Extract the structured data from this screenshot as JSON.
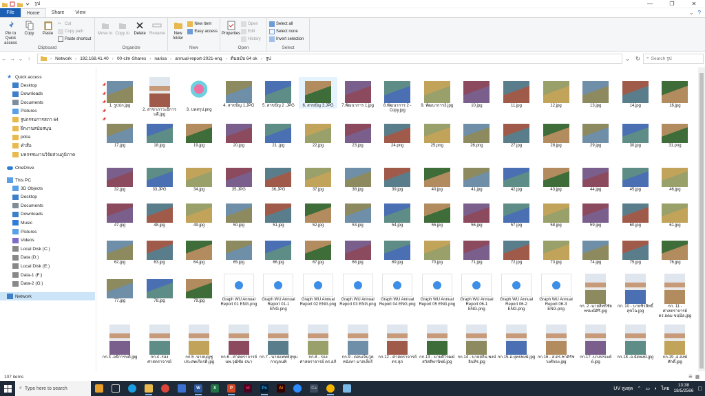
{
  "window": {
    "title": "รูป",
    "controls": [
      "—",
      "❐",
      "✕"
    ]
  },
  "tabs": [
    {
      "label": "File"
    },
    {
      "label": "Home"
    },
    {
      "label": "Share"
    },
    {
      "label": "View"
    }
  ],
  "ribbon": {
    "clipboard": {
      "label": "Clipboard",
      "pin": "Pin to Quick access",
      "copy": "Copy",
      "paste": "Paste",
      "cut": "Cut",
      "copy_path": "Copy path",
      "paste_shortcut": "Paste shortcut"
    },
    "organize": {
      "label": "Organize",
      "move_to": "Move to",
      "copy_to": "Copy to",
      "delete": "Delete",
      "rename": "Rename"
    },
    "new": {
      "label": "New",
      "new_folder": "New folder",
      "new_item": "New item",
      "easy_access": "Easy access"
    },
    "open": {
      "label": "Open",
      "properties": "Properties",
      "open": "Open",
      "edit": "Edit",
      "history": "History"
    },
    "select": {
      "label": "Select",
      "select_all": "Select all",
      "select_none": "Select none",
      "invert": "Invert selection"
    }
  },
  "address": {
    "crumbs": [
      "Network",
      "192.168.41.40",
      "00-clm-Shares",
      "narisa",
      "annual-report-2021-eng",
      "ต้นฉบับ 64 ok",
      "รูป"
    ]
  },
  "search": {
    "placeholder": "Search รูป"
  },
  "nav": {
    "quick_access": "Quick access",
    "quick_items": [
      "Desktop",
      "Downloads",
      "Documents",
      "Pictures",
      "รูปกรรมการสภา 64",
      "ฝึกงานสนับสนุน",
      "pdca",
      "ทำสื่อ",
      "มหกรรมงานวิจัยส่วนภูมิภาค"
    ],
    "onedrive": "OneDrive",
    "this_pc": "This PC",
    "pc_items": [
      "3D Objects",
      "Desktop",
      "Documents",
      "Downloads",
      "Music",
      "Pictures",
      "Videos",
      "Local Disk (C:)",
      "Data (D:)",
      "Local Disk (E:)",
      "Data-1 (F:)",
      "Data-2 (G:)"
    ],
    "network": "Network"
  },
  "files": [
    "1. รูปปก.jpg",
    "2. สาขาภาวะธิการบดี.jpg",
    "3. บทสรุป.png",
    "4. สาขปัญ 1.JPG",
    "5. สาขปัญ 2 .JPG",
    "6. สาขปัญ 3.JPG",
    "7.พัฒนาการ 1.jpg",
    "8.พัฒนาการ 2 - Copy.jpg",
    "9. พัฒนาการ3.jpg",
    "10.jpg",
    "11.jpg",
    "12.jpg",
    "13.jpg",
    "14.jpg",
    "16.jpg",
    "17.jpg",
    "18.jpg",
    "19.jpg",
    "20.jpg",
    "21 .jpg",
    "22.jpg",
    "23.jpg",
    "24.png",
    "25.png",
    "26.png",
    "27.jpg",
    "28.jpg",
    "29.jpg",
    "30.jpg",
    "31.png",
    "32.jpg",
    "33.JPG",
    "34.jpg",
    "35.JPG",
    "36.JPG",
    "37.jpg",
    "38.jpg",
    "39.jpg",
    "40.jpg",
    "41.jpg",
    "42.jpg",
    "43.jpg",
    "44.jpg",
    "45.jpg",
    "46.jpg",
    "47.jpg",
    "48.jpg",
    "49.jpg",
    "50.jpg",
    "51.jpg",
    "52.jpg",
    "53.jpg",
    "54.jpg",
    "55.jpg",
    "56.jpg",
    "57.jpg",
    "58.jpg",
    "59.jpg",
    "60.jpg",
    "61.jpg",
    "62.jpg",
    "63.jpg",
    "64.jpg",
    "65.jpg",
    "66.jpg",
    "67.jpg",
    "68.jpg",
    "69.jpg",
    "70.jpg",
    "71.jpg",
    "72.jpg",
    "73.jpg",
    "74.jpg",
    "75.jpg",
    "76.jpg",
    "77.jpg",
    "78.jpg",
    "79.jpg",
    "Graph WU Annual Report 01 ENG.png",
    "Graph WU Annual Report 01-1 ENG.png",
    "Graph WU Annual Report 02 ENG.png",
    "Graph WU Annual Report 03 ENG.png",
    "Graph WU Annual Report 04 ENG.png",
    "Graph WU Annual Report 05 ENG.png",
    "Graph WU Annual Report 06-1 ENG.png",
    "Graph WU Annual Report 06-2 ENG.png",
    "Graph WU Annual Report 06-3 ENG.png",
    "กก. 2 -นายสิทธิชัย พรมณีศิริ.jpg",
    "กก. 10 - นายชิรสิทธิ์ สุขโฉ.jpg",
    "กก. 11 - ศาสตราจารย์ ดร.อดม ขนฺนิล.jpg",
    "กก.3 -อธิการบดี.jpg",
    "กก.4 -รองศาสตราจารย์",
    "กก.5 -นายบุญชู ประสพเกียรติ.jpg",
    "กก.6 - ศาสตราจารย์ นพ.วุฒิชัย ธนา",
    "กก.7 - นายแพทย์สุขุม กาญจนพิ",
    "กก.8 - รองศาสตราจารย์ ดร.อภิ",
    "กก.9 - ดอนเจ็นวู่ด หนังหา มาสเลี่ยร์",
    "กก.12 - ศาสตราจารย์ ดร.สุภ",
    "กก.13 - นายศิโรฒม์ สวัสดิพานิชย์.jpg",
    "กก.14 - นายสถิน พงษ์อินทิร.jpg",
    "กก.15-อ.ยุทธพงษ์.jpg",
    "กก.16 - ส.ดร.ชาติรัช วงศ์จอง.jpg",
    "กก.17 -นางปรเมย์ผ์.jpg",
    "กก.18 -อ.ฉัตพงษ์.jpg",
    "กก.19 -อ.สงฆ์ศักดิ์.jpg"
  ],
  "status": {
    "count": "107 items"
  },
  "taskbar": {
    "search_placeholder": "Type here to search",
    "apps": [
      "W",
      "X",
      "P",
      "Id",
      "Ps",
      "Ai",
      "Ca"
    ],
    "weather": "UV สูงสุด",
    "lang": "ไทย",
    "time": "13:38",
    "date": "18/5/2566"
  },
  "colors": {
    "accent": "#1a5fb4",
    "selection": "#cce4f7",
    "taskbar": "#1f2a38"
  }
}
